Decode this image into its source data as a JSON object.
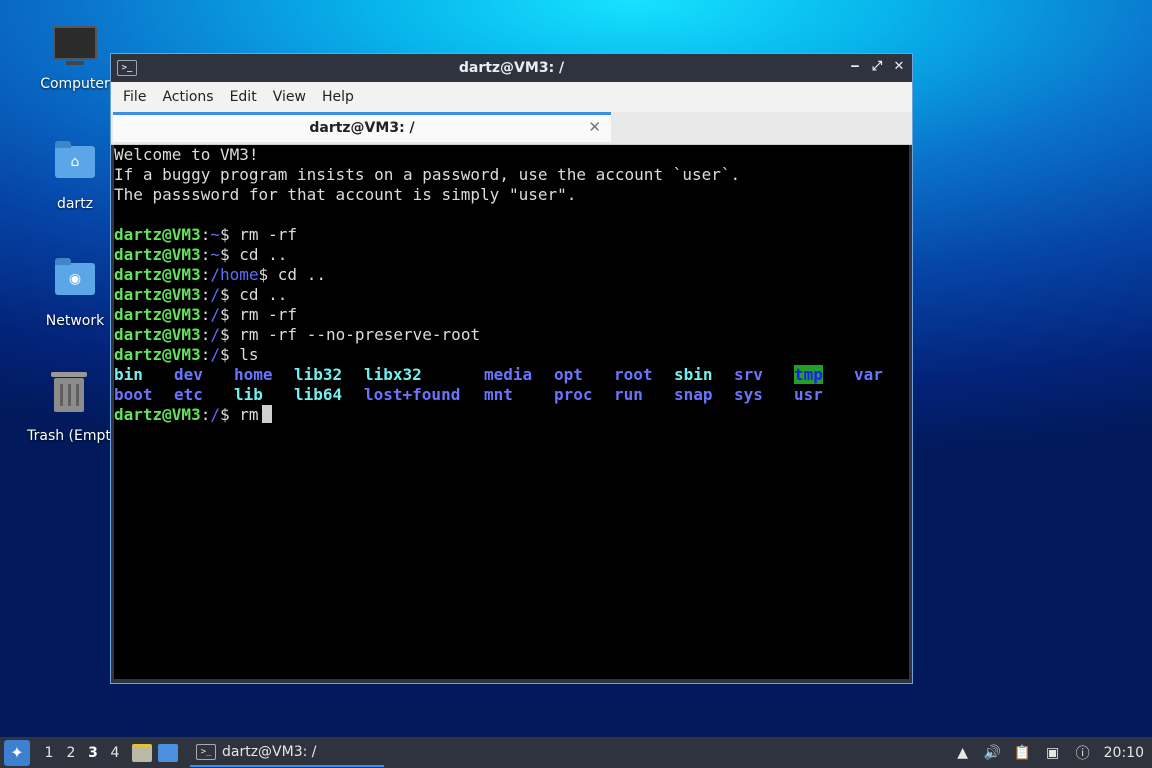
{
  "desktop": {
    "icons": [
      {
        "label": "Computer"
      },
      {
        "label": "dartz"
      },
      {
        "label": "Network"
      },
      {
        "label": "Trash (Empt"
      }
    ]
  },
  "window": {
    "title": "dartz@VM3: /",
    "menu": [
      "File",
      "Actions",
      "Edit",
      "View",
      "Help"
    ],
    "tab_label": "dartz@VM3: /"
  },
  "terminal": {
    "welcome": [
      "Welcome to VM3!",
      "If a buggy program insists on a password, use the account `user`.",
      "The passsword for that account is simply \"user\"."
    ],
    "prompt_user": "dartz@VM3",
    "lines": [
      {
        "path": "~",
        "cmd": " rm -rf"
      },
      {
        "path": "~",
        "cmd": " cd .."
      },
      {
        "path": "/home",
        "cmd": " cd .."
      },
      {
        "path": "/",
        "cmd": " cd .."
      },
      {
        "path": "/",
        "cmd": " rm -rf"
      },
      {
        "path": "/",
        "cmd": " rm -rf --no-preserve-root"
      },
      {
        "path": "/",
        "cmd": " ls"
      }
    ],
    "ls_row1": [
      "bin",
      "dev",
      "home",
      "lib32",
      "libx32",
      "media",
      "opt",
      "root",
      "sbin",
      "srv",
      "tmp",
      "var"
    ],
    "ls_row2": [
      "boot",
      "etc",
      "lib",
      "lib64",
      "lost+found",
      "mnt",
      "proc",
      "run",
      "snap",
      "sys",
      "usr"
    ],
    "current": {
      "path": "/",
      "cmd": " rm"
    }
  },
  "taskbar": {
    "workspaces": [
      "1",
      "2",
      "3",
      "4"
    ],
    "active_workspace": "3",
    "task_label": "dartz@VM3: /",
    "clock": "20:10"
  },
  "colors": {
    "accent": "#3b8ee6",
    "prompt_user": "#63e25a",
    "prompt_path": "#5f6cff"
  }
}
